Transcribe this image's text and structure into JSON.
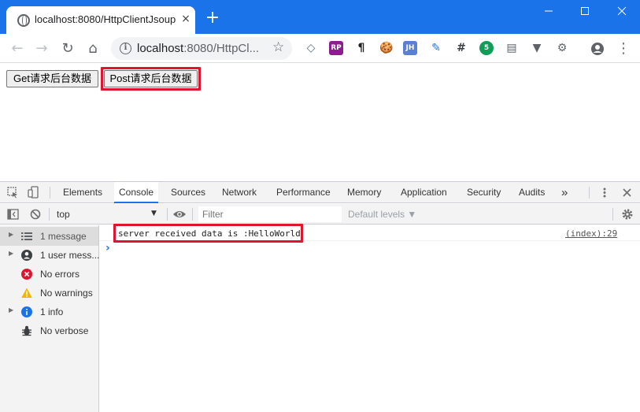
{
  "browser": {
    "tab_title": "localhost:8080/HttpClientJsoup",
    "tab_close": "×",
    "new_tab": "+",
    "window_controls": {
      "minimize": "—",
      "maximize": "☐",
      "close": "✕"
    },
    "nav": {
      "back": "←",
      "forward": "→",
      "reload": "↻",
      "home": "⌂"
    },
    "url_host": "localhost",
    "url_path": ":8080/HttpCl...",
    "star": "☆",
    "extensions": [
      {
        "name": "aws-icon",
        "label": "◇",
        "color": "#5b6e8a"
      },
      {
        "name": "rp-extension-icon",
        "label": "RP",
        "color": "#8b1d8d"
      },
      {
        "name": "pilcrow-icon",
        "label": "¶",
        "color": "#ffffff"
      },
      {
        "name": "cookie-icon",
        "label": "🍪",
        "color": "#ffffff"
      },
      {
        "name": "jh-extension-icon",
        "label": "JH",
        "color": "#5b7fd6"
      },
      {
        "name": "notes-icon",
        "label": "✎",
        "color": "#ffffff"
      },
      {
        "name": "hash-icon",
        "label": "#",
        "color": "#ffffff"
      },
      {
        "name": "badge-extension-icon",
        "label": "5",
        "color": "#1a9e59"
      },
      {
        "name": "page-extension-icon",
        "label": "▤",
        "color": "#ffffff"
      },
      {
        "name": "vue-icon",
        "label": "▼",
        "color": "#ffffff"
      },
      {
        "name": "gear-extension-icon",
        "label": "⚙",
        "color": "#ffffff"
      }
    ],
    "profile": "●",
    "menu": "⋮"
  },
  "page": {
    "get_button": "Get请求后台数据",
    "post_button": "Post请求后台数据"
  },
  "devtools": {
    "tabs": [
      "Elements",
      "Console",
      "Sources",
      "Network",
      "Performance",
      "Memory",
      "Application",
      "Security",
      "Audits"
    ],
    "more_tabs": "»",
    "context": "top",
    "filter_placeholder": "Filter",
    "levels": "Default levels ▼",
    "sidebar": [
      {
        "label": "1 message",
        "count_icon": "list"
      },
      {
        "label": "1 user mess...",
        "count_icon": "user"
      },
      {
        "label": "No errors",
        "count_icon": "error"
      },
      {
        "label": "No warnings",
        "count_icon": "warning"
      },
      {
        "label": "1 info",
        "count_icon": "info"
      },
      {
        "label": "No verbose",
        "count_icon": "verbose"
      }
    ],
    "log_message": "server received data is :HelloWorld",
    "log_source": "(index):29",
    "prompt": "›"
  },
  "colors": {
    "accent": "#1a73e8",
    "highlight": "#e0142e"
  }
}
